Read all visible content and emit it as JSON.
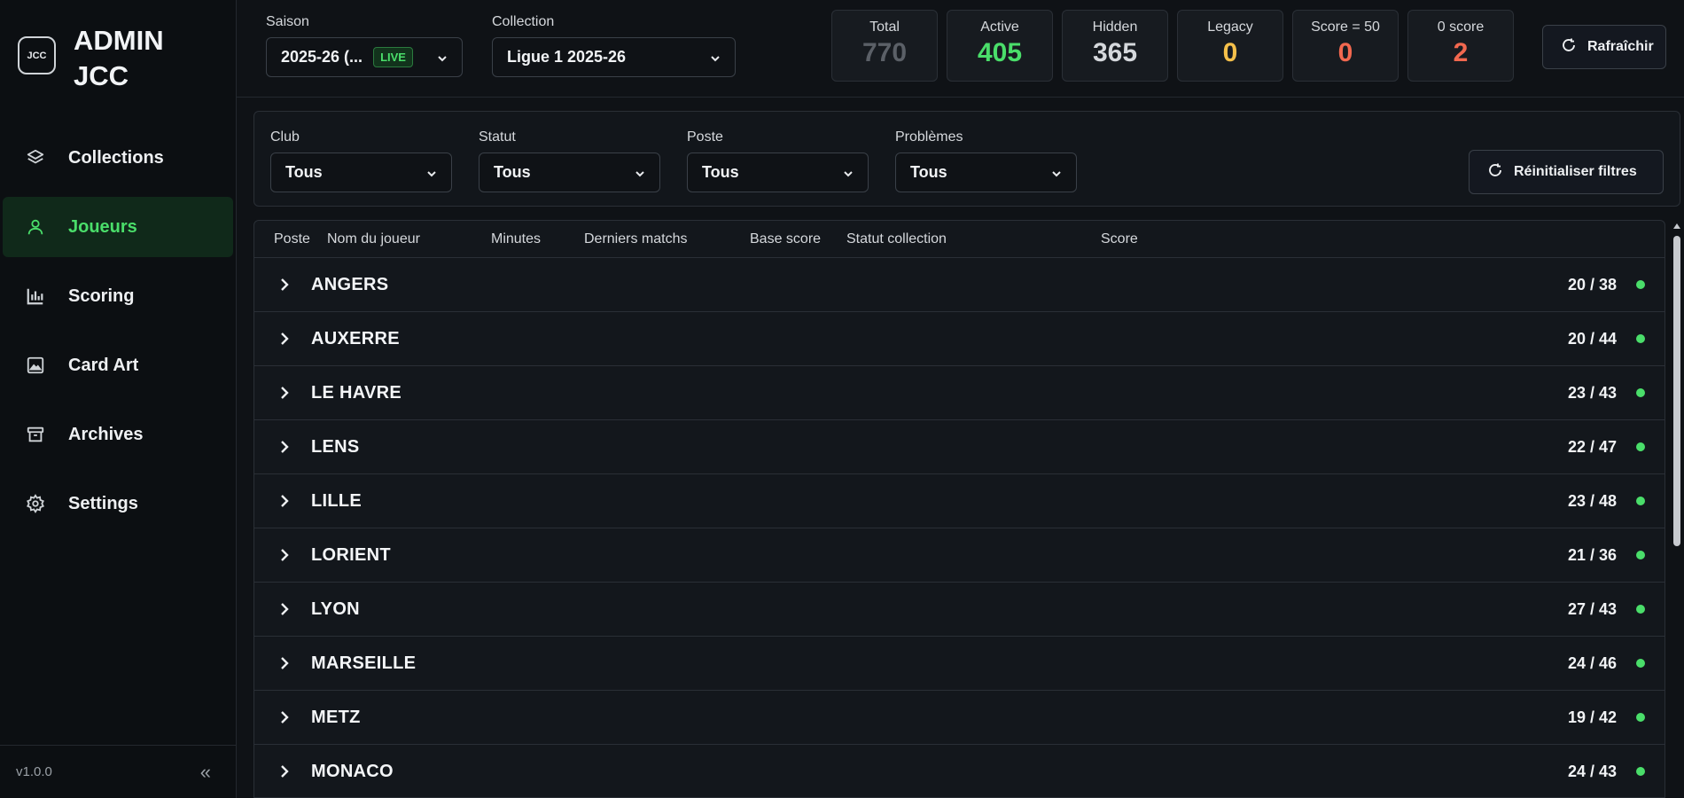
{
  "brand": {
    "logo": "JCC",
    "title": "ADMIN JCC"
  },
  "nav": [
    {
      "label": "Collections",
      "icon": "layers-icon",
      "active": false
    },
    {
      "label": "Joueurs",
      "icon": "user-icon",
      "active": true
    },
    {
      "label": "Scoring",
      "icon": "bar-chart-icon",
      "active": false
    },
    {
      "label": "Card Art",
      "icon": "image-icon",
      "active": false
    },
    {
      "label": "Archives",
      "icon": "archive-icon",
      "active": false
    },
    {
      "label": "Settings",
      "icon": "gear-icon",
      "active": false
    }
  ],
  "footer": {
    "version": "v1.0.0",
    "collapse_icon": "«"
  },
  "topbar": {
    "season_label": "Saison",
    "season_value": "2025-26 (...",
    "live_badge": "LIVE",
    "collection_label": "Collection",
    "collection_value": "Ligue 1 2025-26",
    "refresh_label": "Rafraîchir"
  },
  "stats": [
    {
      "label": "Total",
      "value": "770",
      "color": "#5b6067"
    },
    {
      "label": "Active",
      "value": "405",
      "color": "#4ade6a"
    },
    {
      "label": "Hidden",
      "value": "365",
      "color": "#d5d8dc"
    },
    {
      "label": "Legacy",
      "value": "0",
      "color": "#f5c04a"
    },
    {
      "label": "Score = 50",
      "value": "0",
      "color": "#f2684f"
    },
    {
      "label": "0 score",
      "value": "2",
      "color": "#f2684f"
    }
  ],
  "filters": {
    "club_label": "Club",
    "club_value": "Tous",
    "status_label": "Statut",
    "status_value": "Tous",
    "position_label": "Poste",
    "position_value": "Tous",
    "problems_label": "Problèmes",
    "problems_value": "Tous",
    "reset_label": "Réinitialiser filtres"
  },
  "table": {
    "headers": [
      "Poste",
      "Nom du joueur",
      "Minutes",
      "Derniers matchs",
      "Base score",
      "Statut collection",
      "Score"
    ],
    "rows": [
      {
        "club": "ANGERS",
        "count": "20 / 38"
      },
      {
        "club": "AUXERRE",
        "count": "20 / 44"
      },
      {
        "club": "LE HAVRE",
        "count": "23 / 43"
      },
      {
        "club": "LENS",
        "count": "22 / 47"
      },
      {
        "club": "LILLE",
        "count": "23 / 48"
      },
      {
        "club": "LORIENT",
        "count": "21 / 36"
      },
      {
        "club": "LYON",
        "count": "27 / 43"
      },
      {
        "club": "MARSEILLE",
        "count": "24 / 46"
      },
      {
        "club": "METZ",
        "count": "19 / 42"
      },
      {
        "club": "MONACO",
        "count": "24 / 43"
      }
    ],
    "status_dot_color": "#4ade6a"
  }
}
